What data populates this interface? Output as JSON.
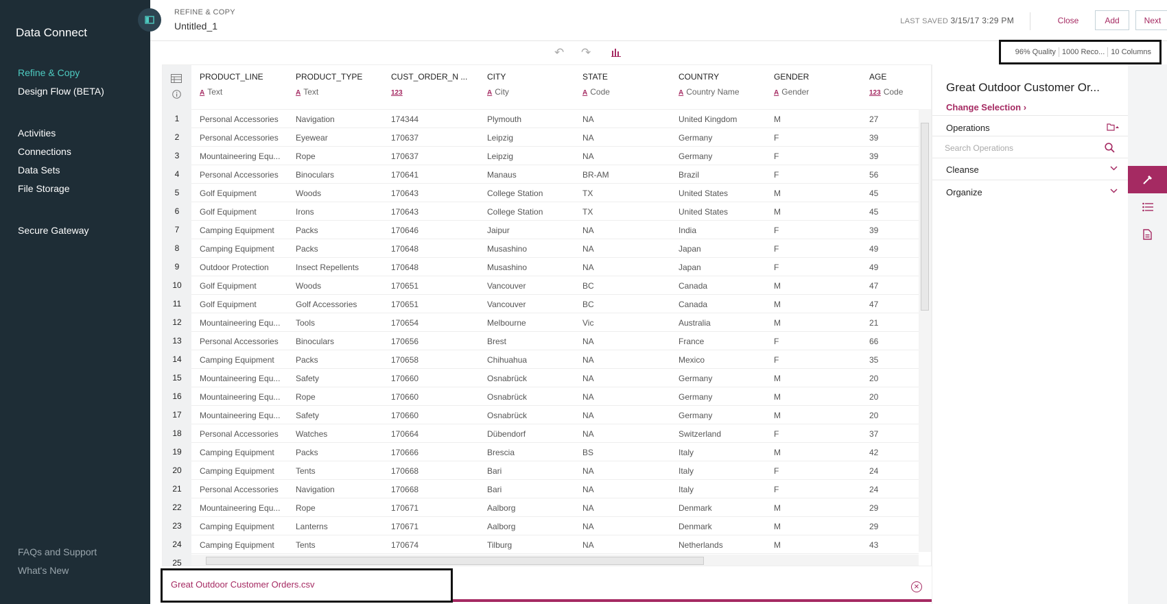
{
  "sidebar": {
    "brand": "Data Connect",
    "nav": [
      "Refine & Copy",
      "Design Flow (BETA)",
      "Activities",
      "Connections",
      "Data Sets",
      "File Storage",
      "Secure Gateway"
    ],
    "footer": [
      "FAQs and Support",
      "What's New"
    ]
  },
  "header": {
    "kicker": "REFINE & COPY",
    "title": "Untitled_1",
    "last_saved_label": "LAST SAVED",
    "last_saved_value": "3/15/17 3:29 PM",
    "close": "Close",
    "add": "Add",
    "next": "Next"
  },
  "stats": {
    "quality": "96% Quality",
    "records": "1000 Reco...",
    "columns": "10 Columns"
  },
  "grid": {
    "columns": [
      {
        "name": "PRODUCT_LINE",
        "kind": "A",
        "type": "Text"
      },
      {
        "name": "PRODUCT_TYPE",
        "kind": "A",
        "type": "Text"
      },
      {
        "name": "CUST_ORDER_N ...",
        "kind": "123",
        "type": ""
      },
      {
        "name": "CITY",
        "kind": "A",
        "type": "City"
      },
      {
        "name": "STATE",
        "kind": "A",
        "type": "Code"
      },
      {
        "name": "COUNTRY",
        "kind": "A",
        "type": "Country Name"
      },
      {
        "name": "GENDER",
        "kind": "A",
        "type": "Gender"
      },
      {
        "name": "AGE",
        "kind": "123",
        "type": "Code"
      }
    ],
    "rows": [
      [
        "1",
        "Personal Accessories",
        "Navigation",
        "174344",
        "Plymouth",
        "NA",
        "United Kingdom",
        "M",
        "27"
      ],
      [
        "2",
        "Personal Accessories",
        "Eyewear",
        "170637",
        "Leipzig",
        "NA",
        "Germany",
        "F",
        "39"
      ],
      [
        "3",
        "Mountaineering Equ...",
        "Rope",
        "170637",
        "Leipzig",
        "NA",
        "Germany",
        "F",
        "39"
      ],
      [
        "4",
        "Personal Accessories",
        "Binoculars",
        "170641",
        "Manaus",
        "BR-AM",
        "Brazil",
        "F",
        "56"
      ],
      [
        "5",
        "Golf Equipment",
        "Woods",
        "170643",
        "College Station",
        "TX",
        "United States",
        "M",
        "45"
      ],
      [
        "6",
        "Golf Equipment",
        "Irons",
        "170643",
        "College Station",
        "TX",
        "United States",
        "M",
        "45"
      ],
      [
        "7",
        "Camping Equipment",
        "Packs",
        "170646",
        "Jaipur",
        "NA",
        "India",
        "F",
        "39"
      ],
      [
        "8",
        "Camping Equipment",
        "Packs",
        "170648",
        "Musashino",
        "NA",
        "Japan",
        "F",
        "49"
      ],
      [
        "9",
        "Outdoor Protection",
        "Insect Repellents",
        "170648",
        "Musashino",
        "NA",
        "Japan",
        "F",
        "49"
      ],
      [
        "10",
        "Golf Equipment",
        "Woods",
        "170651",
        "Vancouver",
        "BC",
        "Canada",
        "M",
        "47"
      ],
      [
        "11",
        "Golf Equipment",
        "Golf Accessories",
        "170651",
        "Vancouver",
        "BC",
        "Canada",
        "M",
        "47"
      ],
      [
        "12",
        "Mountaineering Equ...",
        "Tools",
        "170654",
        "Melbourne",
        "Vic",
        "Australia",
        "M",
        "21"
      ],
      [
        "13",
        "Personal Accessories",
        "Binoculars",
        "170656",
        "Brest",
        "NA",
        "France",
        "F",
        "66"
      ],
      [
        "14",
        "Camping Equipment",
        "Packs",
        "170658",
        "Chihuahua",
        "NA",
        "Mexico",
        "F",
        "35"
      ],
      [
        "15",
        "Mountaineering Equ...",
        "Safety",
        "170660",
        "Osnabrück",
        "NA",
        "Germany",
        "M",
        "20"
      ],
      [
        "16",
        "Mountaineering Equ...",
        "Rope",
        "170660",
        "Osnabrück",
        "NA",
        "Germany",
        "M",
        "20"
      ],
      [
        "17",
        "Mountaineering Equ...",
        "Safety",
        "170660",
        "Osnabrück",
        "NA",
        "Germany",
        "M",
        "20"
      ],
      [
        "18",
        "Personal Accessories",
        "Watches",
        "170664",
        "Dübendorf",
        "NA",
        "Switzerland",
        "F",
        "37"
      ],
      [
        "19",
        "Camping Equipment",
        "Packs",
        "170666",
        "Brescia",
        "BS",
        "Italy",
        "M",
        "42"
      ],
      [
        "20",
        "Camping Equipment",
        "Tents",
        "170668",
        "Bari",
        "NA",
        "Italy",
        "F",
        "24"
      ],
      [
        "21",
        "Personal Accessories",
        "Navigation",
        "170668",
        "Bari",
        "NA",
        "Italy",
        "F",
        "24"
      ],
      [
        "22",
        "Mountaineering Equ...",
        "Rope",
        "170671",
        "Aalborg",
        "NA",
        "Denmark",
        "M",
        "29"
      ],
      [
        "23",
        "Camping Equipment",
        "Lanterns",
        "170671",
        "Aalborg",
        "NA",
        "Denmark",
        "M",
        "29"
      ],
      [
        "24",
        "Camping Equipment",
        "Tents",
        "170674",
        "Tilburg",
        "NA",
        "Netherlands",
        "M",
        "43"
      ],
      [
        "25",
        "",
        "",
        "",
        "",
        "",
        "",
        "",
        ""
      ]
    ]
  },
  "file_tab": {
    "name": "Great Outdoor Customer Orders.csv"
  },
  "panel": {
    "title": "Great Outdoor Customer Or...",
    "change_selection": "Change Selection",
    "operations": "Operations",
    "search_placeholder": "Search Operations",
    "sections": [
      "Cleanse",
      "Organize"
    ]
  },
  "colors": {
    "sidebar": "#1e2d36",
    "accent": "#a52a62",
    "active_nav": "#4ecbc1"
  }
}
